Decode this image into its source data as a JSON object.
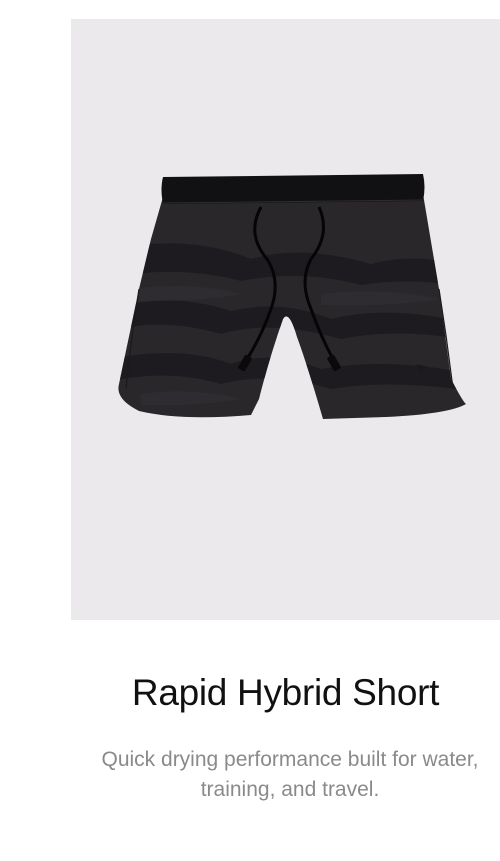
{
  "product": {
    "title": "Rapid Hybrid Short",
    "description": "Quick drying performance built for water, training, and travel.",
    "image_icon": "black-camo-shorts-image"
  },
  "colors": {
    "image_background": "#ebe9ec",
    "title": "#111111",
    "description": "#8a8a8a",
    "short_base": "#262427",
    "camo_dark": "#1b1a1d"
  }
}
